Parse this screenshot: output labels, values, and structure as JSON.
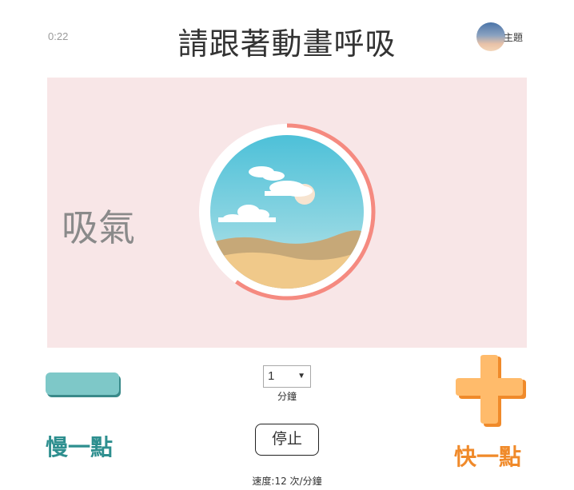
{
  "header": {
    "timer": "0:22",
    "title": "請跟著動畫呼吸",
    "theme_label": "主題",
    "theme_icon": "theme-thumbnail-icon"
  },
  "stage": {
    "phase_label": "吸氣",
    "progress_fraction": 0.6,
    "ring_color": "#f58a80",
    "background_color": "#f8e6e7"
  },
  "controls": {
    "slower_label": "慢一點",
    "faster_label": "快一點",
    "slower_color": "#7ec8c8",
    "faster_color": "#ffbb6b",
    "duration_value": "1",
    "duration_unit": "分鐘",
    "stop_label": "停止",
    "speed_text": "速度:12 次/分鐘"
  }
}
